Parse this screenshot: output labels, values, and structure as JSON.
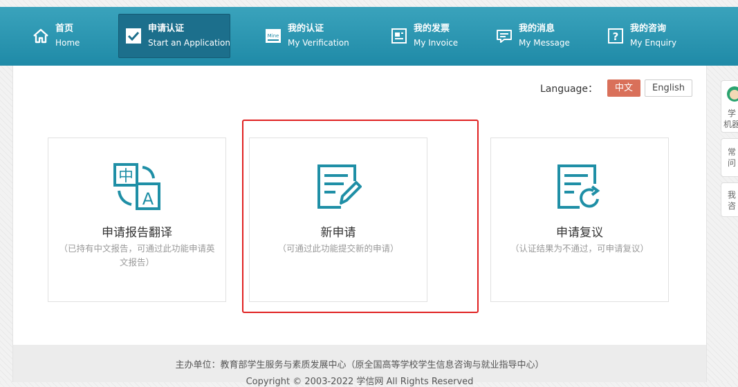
{
  "nav": [
    {
      "cn": "首页",
      "en": "Home",
      "icon": "home-icon",
      "active": false
    },
    {
      "cn": "申请认证",
      "en": "Start an Application",
      "icon": "check-box-icon",
      "active": true
    },
    {
      "cn": "我的认证",
      "en": "My Verification",
      "icon": "mine-certificate-icon",
      "active": false
    },
    {
      "cn": "我的发票",
      "en": "My Invoice",
      "icon": "invoice-icon",
      "active": false
    },
    {
      "cn": "我的消息",
      "en": "My Message",
      "icon": "message-icon",
      "active": false
    },
    {
      "cn": "我的咨询",
      "en": "My Enquiry",
      "icon": "question-icon",
      "active": false
    }
  ],
  "icon_mine_text": "Mine",
  "icon_question_text": "?",
  "language": {
    "label": "Language：",
    "options": [
      "中文",
      "English"
    ],
    "selected": "中文"
  },
  "cards": [
    {
      "title": "申请报告翻译",
      "desc": "（已持有中文报告，可通过此功能申请英文报告）",
      "icon": "translate-icon",
      "icon_cn": "中",
      "icon_en": "A"
    },
    {
      "title": "新申请",
      "desc": "（可通过此功能提交新的申请）",
      "icon": "new-application-icon"
    },
    {
      "title": "申请复议",
      "desc": "（认证结果为不通过，可申请复议）",
      "icon": "reconsideration-icon"
    }
  ],
  "footer": {
    "line1": "主办单位：教育部学生服务与素质发展中心（原全国高等学校学生信息咨询与就业指导中心）",
    "line2": "Copyright © 2003-2022 学信网 All Rights Reserved"
  },
  "side": [
    {
      "text1": "学",
      "text2": "机器"
    },
    {
      "text1": "常",
      "text2": "问"
    },
    {
      "text1": "我",
      "text2": "咨"
    }
  ],
  "colors": {
    "nav": "#2596b4",
    "nav_active": "#1c6f8c",
    "accent_orange": "#d9705a",
    "icon_teal": "#1f8fa6",
    "highlight_red": "#e02020"
  }
}
